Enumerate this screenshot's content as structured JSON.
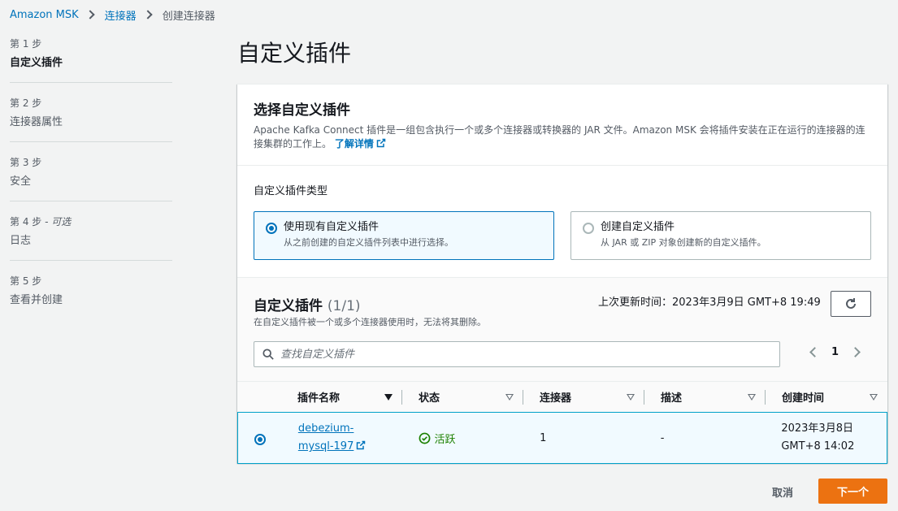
{
  "breadcrumb": {
    "root": "Amazon MSK",
    "level2": "连接器",
    "current": "创建连接器"
  },
  "steps": [
    {
      "num": "第 1 步",
      "optional": "",
      "title": "自定义插件",
      "active": true
    },
    {
      "num": "第 2 步",
      "optional": "",
      "title": "连接器属性",
      "active": false
    },
    {
      "num": "第 3 步",
      "optional": "",
      "title": "安全",
      "active": false
    },
    {
      "num": "第 4 步",
      "optional": " - 可选",
      "title": "日志",
      "active": false
    },
    {
      "num": "第 5 步",
      "optional": "",
      "title": "查看并创建",
      "active": false
    }
  ],
  "page_title": "自定义插件",
  "select_section": {
    "title": "选择自定义插件",
    "description": "Apache Kafka Connect 插件是一组包含执行一个或多个连接器或转换器的 JAR 文件。Amazon MSK 会将插件安装在正在运行的连接器的连接集群的工作上。",
    "learn_more": "了解详情"
  },
  "plugin_type": {
    "label": "自定义插件类型",
    "options": [
      {
        "title": "使用现有自定义插件",
        "desc": "从之前创建的自定义插件列表中进行选择。",
        "selected": true
      },
      {
        "title": "创建自定义插件",
        "desc": "从 JAR 或 ZIP 对象创建新的自定义插件。",
        "selected": false
      }
    ]
  },
  "plugins_table": {
    "title": "自定义插件",
    "count": "(1/1)",
    "description": "在自定义插件被一个或多个连接器使用时，无法将其删除。",
    "last_updated": "上次更新时间：2023年3月9日 GMT+8 19:49",
    "search_placeholder": "查找自定义插件",
    "page": "1",
    "columns": [
      "插件名称",
      "状态",
      "连接器",
      "描述",
      "创建时间"
    ],
    "rows": [
      {
        "name_line1": "debezium-",
        "name_line2": "mysql-197",
        "status": "活跃",
        "connectors": "1",
        "description": "-",
        "created_line1": "2023年3月8日",
        "created_line2": "GMT+8 14:02"
      }
    ]
  },
  "footer": {
    "cancel": "取消",
    "next": "下一个"
  },
  "colors": {
    "accent": "#0073bb",
    "primary_button": "#ec7211",
    "success": "#1d8102"
  }
}
